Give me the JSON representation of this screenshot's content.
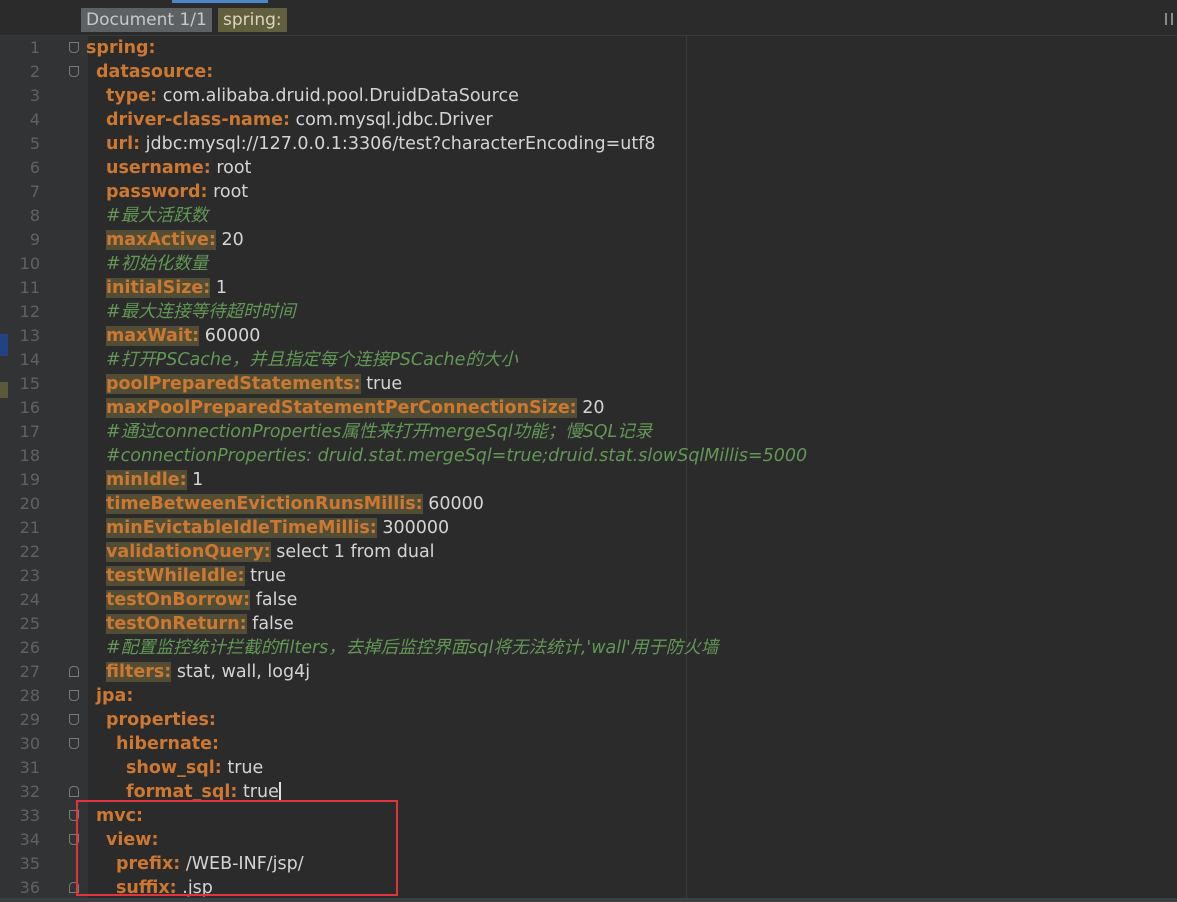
{
  "breadcrumb": {
    "document": "Document 1/1",
    "node": "spring:"
  },
  "colors": {
    "background": "#2b2b2b",
    "key": "#cc7832",
    "value": "#d4d4d4",
    "comment": "#629755",
    "key_highlight": "#514e35",
    "annotation_box": "#e0353e"
  },
  "lines": [
    {
      "n": "1",
      "indent": 0,
      "key": "spring:",
      "value": "",
      "comment": "",
      "hl": false,
      "fold": "open"
    },
    {
      "n": "2",
      "indent": 1,
      "key": "datasource:",
      "value": "",
      "comment": "",
      "hl": false,
      "fold": "open"
    },
    {
      "n": "3",
      "indent": 2,
      "key": "type:",
      "value": " com.alibaba.druid.pool.DruidDataSource",
      "comment": "",
      "hl": false,
      "fold": ""
    },
    {
      "n": "4",
      "indent": 2,
      "key": "driver-class-name:",
      "value": " com.mysql.jdbc.Driver",
      "comment": "",
      "hl": false,
      "fold": ""
    },
    {
      "n": "5",
      "indent": 2,
      "key": "url:",
      "value": " jdbc:mysql://127.0.0.1:3306/test?characterEncoding=utf8",
      "comment": "",
      "hl": false,
      "fold": ""
    },
    {
      "n": "6",
      "indent": 2,
      "key": "username:",
      "value": " root",
      "comment": "",
      "hl": false,
      "fold": ""
    },
    {
      "n": "7",
      "indent": 2,
      "key": "password:",
      "value": " root",
      "comment": "",
      "hl": false,
      "fold": ""
    },
    {
      "n": "8",
      "indent": 2,
      "key": "",
      "value": "",
      "comment": "#最大活跃数",
      "hl": false,
      "fold": ""
    },
    {
      "n": "9",
      "indent": 2,
      "key": "maxActive:",
      "value": " 20",
      "comment": "",
      "hl": true,
      "fold": ""
    },
    {
      "n": "10",
      "indent": 2,
      "key": "",
      "value": "",
      "comment": "#初始化数量",
      "hl": false,
      "fold": ""
    },
    {
      "n": "11",
      "indent": 2,
      "key": "initialSize:",
      "value": " 1",
      "comment": "",
      "hl": true,
      "fold": ""
    },
    {
      "n": "12",
      "indent": 2,
      "key": "",
      "value": "",
      "comment": "#最大连接等待超时时间",
      "hl": false,
      "fold": ""
    },
    {
      "n": "13",
      "indent": 2,
      "key": "maxWait:",
      "value": " 60000",
      "comment": "",
      "hl": true,
      "fold": ""
    },
    {
      "n": "14",
      "indent": 2,
      "key": "",
      "value": "",
      "comment": "#打开PSCache，并且指定每个连接PSCache的大小",
      "hl": false,
      "fold": ""
    },
    {
      "n": "15",
      "indent": 2,
      "key": "poolPreparedStatements:",
      "value": " true",
      "comment": "",
      "hl": true,
      "fold": ""
    },
    {
      "n": "16",
      "indent": 2,
      "key": "maxPoolPreparedStatementPerConnectionSize:",
      "value": " 20",
      "comment": "",
      "hl": true,
      "fold": ""
    },
    {
      "n": "17",
      "indent": 2,
      "key": "",
      "value": "",
      "comment": "#通过connectionProperties属性来打开mergeSql功能；慢SQL记录",
      "hl": false,
      "fold": ""
    },
    {
      "n": "18",
      "indent": 2,
      "key": "",
      "value": "",
      "comment": "#connectionProperties: druid.stat.mergeSql=true;druid.stat.slowSqlMillis=5000",
      "hl": false,
      "fold": ""
    },
    {
      "n": "19",
      "indent": 2,
      "key": "minIdle:",
      "value": " 1",
      "comment": "",
      "hl": true,
      "fold": ""
    },
    {
      "n": "20",
      "indent": 2,
      "key": "timeBetweenEvictionRunsMillis:",
      "value": " 60000",
      "comment": "",
      "hl": true,
      "fold": ""
    },
    {
      "n": "21",
      "indent": 2,
      "key": "minEvictableIdleTimeMillis:",
      "value": " 300000",
      "comment": "",
      "hl": true,
      "fold": ""
    },
    {
      "n": "22",
      "indent": 2,
      "key": "validationQuery:",
      "value": " select 1 from dual",
      "comment": "",
      "hl": true,
      "fold": ""
    },
    {
      "n": "23",
      "indent": 2,
      "key": "testWhileIdle:",
      "value": " true",
      "comment": "",
      "hl": true,
      "fold": ""
    },
    {
      "n": "24",
      "indent": 2,
      "key": "testOnBorrow:",
      "value": " false",
      "comment": "",
      "hl": true,
      "fold": ""
    },
    {
      "n": "25",
      "indent": 2,
      "key": "testOnReturn:",
      "value": " false",
      "comment": "",
      "hl": true,
      "fold": ""
    },
    {
      "n": "26",
      "indent": 2,
      "key": "",
      "value": "",
      "comment": "#配置监控统计拦截的filters，去掉后监控界面sql将无法统计,'wall'用于防火墙",
      "hl": false,
      "fold": ""
    },
    {
      "n": "27",
      "indent": 2,
      "key": "filters:",
      "value": " stat, wall, log4j",
      "comment": "",
      "hl": true,
      "fold": "close"
    },
    {
      "n": "28",
      "indent": 1,
      "key": "jpa:",
      "value": "",
      "comment": "",
      "hl": false,
      "fold": "open"
    },
    {
      "n": "29",
      "indent": 2,
      "key": "properties:",
      "value": "",
      "comment": "",
      "hl": false,
      "fold": "open"
    },
    {
      "n": "30",
      "indent": 3,
      "key": "hibernate:",
      "value": "",
      "comment": "",
      "hl": false,
      "fold": "open"
    },
    {
      "n": "31",
      "indent": 4,
      "key": "show_sql:",
      "value": " true",
      "comment": "",
      "hl": false,
      "fold": ""
    },
    {
      "n": "32",
      "indent": 4,
      "key": "format_sql:",
      "value": " true",
      "comment": "",
      "hl": false,
      "fold": "close",
      "caret": true
    },
    {
      "n": "33",
      "indent": 1,
      "key": "mvc:",
      "value": "",
      "comment": "",
      "hl": false,
      "fold": "open"
    },
    {
      "n": "34",
      "indent": 2,
      "key": "view:",
      "value": "",
      "comment": "",
      "hl": false,
      "fold": "open"
    },
    {
      "n": "35",
      "indent": 3,
      "key": "prefix:",
      "value": " /WEB-INF/jsp/",
      "comment": "",
      "hl": false,
      "fold": ""
    },
    {
      "n": "36",
      "indent": 3,
      "key": "suffix:",
      "value": " .jsp",
      "comment": "",
      "hl": false,
      "fold": "close"
    }
  ]
}
